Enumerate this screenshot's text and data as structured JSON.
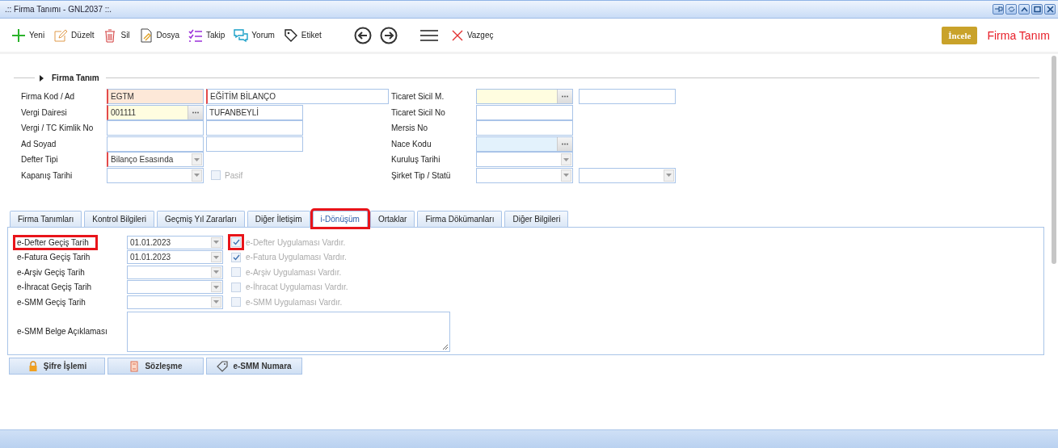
{
  "window": {
    "title": ".:: Firma Tanımı - GNL2037 ::."
  },
  "toolbar": [
    {
      "kind": "add",
      "label": "Yeni"
    },
    {
      "kind": "edit",
      "label": "Düzelt"
    },
    {
      "kind": "delete",
      "label": "Sil"
    },
    {
      "kind": "file",
      "label": "Dosya"
    },
    {
      "kind": "track",
      "label": "Takip"
    },
    {
      "kind": "comment",
      "label": "Yorum"
    },
    {
      "kind": "tag",
      "label": "Etiket"
    }
  ],
  "cancel": {
    "label": "Vazgeç"
  },
  "inspect_button": {
    "label": "İncele"
  },
  "page_title": "Firma Tanım",
  "section": {
    "title": "Firma Tanım"
  },
  "left_rows": [
    {
      "label": "Firma Kod / Ad",
      "fields": [
        {
          "kind": "text",
          "value": "EGTM",
          "required": true,
          "color": "#fde8d8"
        },
        {
          "kind": "text",
          "value": "EĞİTİM BİLANÇO",
          "required": true,
          "color": "#ffffff"
        }
      ]
    },
    {
      "label": "Vergi Dairesi",
      "fields": [
        {
          "kind": "lookup",
          "value": "001111",
          "required": true,
          "color": "#fffde0"
        },
        {
          "kind": "text",
          "value": "TUFANBEYLİ",
          "required": false,
          "color": "#ffffff"
        }
      ]
    },
    {
      "label": "Vergi / TC Kimlik No",
      "fields": [
        {
          "kind": "text",
          "required": false,
          "color": "#ffffff"
        },
        {
          "kind": "text",
          "required": false,
          "color": "#ffffff"
        }
      ]
    },
    {
      "label": "Ad Soyad",
      "fields": [
        {
          "kind": "text",
          "required": false,
          "color": "#ffffff"
        },
        {
          "kind": "text",
          "required": false,
          "color": "#ffffff"
        }
      ]
    },
    {
      "label": "Defter Tipi",
      "fields": [
        {
          "kind": "combo",
          "value": "Bilanço Esasında",
          "required": true,
          "color": "#ffffff"
        }
      ]
    },
    {
      "label": "Kapanış Tarihi",
      "fields": [
        {
          "kind": "combo",
          "required": false,
          "color": "#ffffff"
        },
        {
          "kind": "checkbox",
          "label": "Pasif",
          "checked": false,
          "disabled": true
        }
      ]
    }
  ],
  "right_rows": [
    {
      "label": "Ticaret Sicil M.",
      "fields": [
        {
          "kind": "lookup",
          "required": false,
          "color": "#fffde0"
        },
        {
          "kind": "text",
          "required": false,
          "color": "#ffffff"
        }
      ]
    },
    {
      "label": "Ticaret Sicil No",
      "fields": [
        {
          "kind": "text",
          "required": false,
          "color": "#ffffff"
        }
      ]
    },
    {
      "label": "Mersis No",
      "fields": [
        {
          "kind": "text",
          "required": false,
          "color": "#ffffff"
        }
      ]
    },
    {
      "label": "Nace Kodu",
      "fields": [
        {
          "kind": "lookup",
          "required": false,
          "color": "#e3f2fc"
        }
      ]
    },
    {
      "label": "Kuruluş Tarihi",
      "fields": [
        {
          "kind": "combo",
          "required": false,
          "color": "#ffffff"
        }
      ]
    },
    {
      "label": "Şirket Tip / Statü",
      "fields": [
        {
          "kind": "combo",
          "required": false,
          "color": "#ffffff"
        },
        {
          "kind": "combo",
          "required": false,
          "color": "#ffffff"
        }
      ]
    }
  ],
  "tabs": [
    {
      "label": "Firma Tanımları",
      "selected": false,
      "highlighted": false
    },
    {
      "label": "Kontrol Bilgileri",
      "selected": false,
      "highlighted": false
    },
    {
      "label": "Geçmiş Yıl Zararları",
      "selected": false,
      "highlighted": false
    },
    {
      "label": "Diğer İletişim",
      "selected": false,
      "highlighted": false
    },
    {
      "label": "i-Dönüşüm",
      "selected": true,
      "highlighted": true
    },
    {
      "label": "Ortaklar",
      "selected": false,
      "highlighted": false
    },
    {
      "label": "Firma Dökümanları",
      "selected": false,
      "highlighted": false
    },
    {
      "label": "Diğer Bilgileri",
      "selected": false,
      "highlighted": false
    }
  ],
  "transition_rows": [
    {
      "label": "e-Defter Geçiş Tarih",
      "date": "01.01.2023",
      "check_label": "e-Defter Uygulaması Vardır.",
      "checked": true,
      "label_highlighted": true,
      "check_highlighted": true
    },
    {
      "label": "e-Fatura Geçiş Tarih",
      "date": "01.01.2023",
      "check_label": "e-Fatura Uygulaması Vardır.",
      "checked": true,
      "label_highlighted": false,
      "check_highlighted": false
    },
    {
      "label": "e-Arşiv Geçiş Tarih",
      "check_label": "e-Arşiv Uygulaması Vardır.",
      "checked": false,
      "label_highlighted": false,
      "check_highlighted": false
    },
    {
      "label": "e-İhracat Geçiş Tarih",
      "check_label": "e-İhracat Uygulaması Vardır.",
      "checked": false,
      "label_highlighted": false,
      "check_highlighted": false
    },
    {
      "label": "e-SMM Geçiş Tarih",
      "check_label": "e-SMM Uygulaması Vardır.",
      "checked": false,
      "label_highlighted": false,
      "check_highlighted": false
    }
  ],
  "note": {
    "label": "e-SMM Belge Açıklaması"
  },
  "actions": [
    {
      "kind": "lock",
      "label": "Şifre İşlemi"
    },
    {
      "kind": "contract",
      "label": "Sözleşme"
    },
    {
      "kind": "tag",
      "label": "e-SMM Numara"
    }
  ]
}
